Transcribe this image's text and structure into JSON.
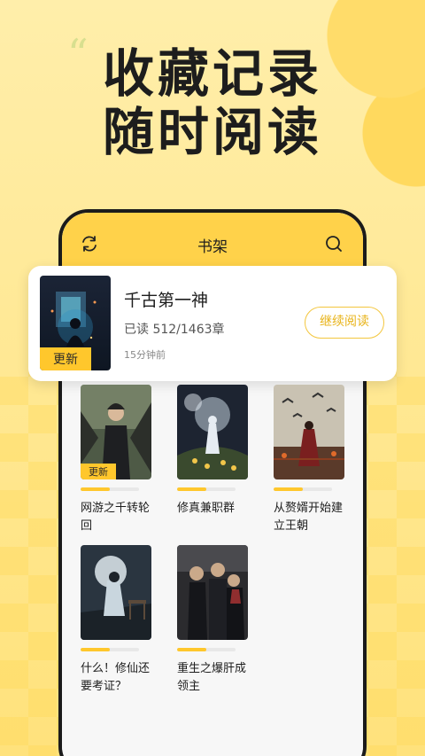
{
  "promo": {
    "quote_mark": "“",
    "line1": "收藏记录",
    "line2": "随时阅读"
  },
  "topbar": {
    "title": "书架",
    "left_icon": "refresh-icon",
    "right_icon": "search-icon"
  },
  "featured": {
    "title": "千古第一神",
    "progress": "已读 512/1463章",
    "time": "15分钟前",
    "badge": "更新",
    "button": "继续阅读"
  },
  "books": [
    {
      "title": "网游之千转轮回",
      "badge": "更新",
      "progress": 0.5
    },
    {
      "title": "修真兼职群",
      "badge": "",
      "progress": 0.5
    },
    {
      "title": "从赘婿开始建立王朝",
      "badge": "",
      "progress": 0.5
    },
    {
      "title": "什么！修仙还要考证？",
      "badge": "",
      "progress": 0.5
    },
    {
      "title": "重生之爆肝成领主",
      "badge": "",
      "progress": 0.5
    }
  ],
  "colors": {
    "accent": "#ffd24a",
    "badge": "#ffc72c",
    "button_text": "#e8b318"
  }
}
